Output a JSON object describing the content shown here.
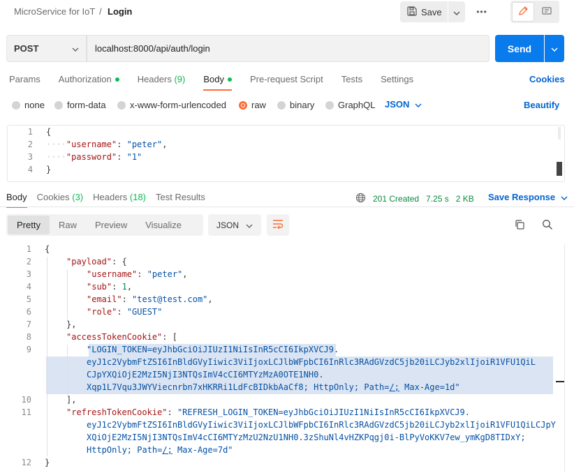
{
  "breadcrumb": {
    "parent": "MicroService for IoT",
    "separator": "/",
    "current": "Login"
  },
  "toolbar": {
    "save_label": "Save",
    "more_label": "•••"
  },
  "request": {
    "method": "POST",
    "url": "localhost:8000/api/auth/login",
    "send_label": "Send"
  },
  "request_tabs": [
    {
      "label": "Params"
    },
    {
      "label": "Authorization",
      "dot": true
    },
    {
      "label": "Headers",
      "count": "(9)"
    },
    {
      "label": "Body",
      "dot": true,
      "active": true
    },
    {
      "label": "Pre-request Script"
    },
    {
      "label": "Tests"
    },
    {
      "label": "Settings"
    }
  ],
  "cookies_label": "Cookies",
  "body_types": {
    "none": "none",
    "form_data": "form-data",
    "urlencoded": "x-www-form-urlencoded",
    "raw": "raw",
    "binary": "binary",
    "graphql": "GraphQL",
    "selected": "raw"
  },
  "raw_format": "JSON",
  "beautify_label": "Beautify",
  "request_body": {
    "line_numbers": [
      "1",
      "2",
      "3",
      "4"
    ],
    "username_key": "\"username\"",
    "username_val": "\"peter\"",
    "password_key": "\"password\"",
    "password_val": "\"1\""
  },
  "response_tabs": {
    "body": "Body",
    "cookies": "Cookies",
    "cookies_count": "(3)",
    "headers": "Headers",
    "headers_count": "(18)",
    "test_results": "Test Results"
  },
  "status": {
    "code": "201 Created",
    "time": "7.25 s",
    "size": "2 KB"
  },
  "save_response_label": "Save Response",
  "view_modes": [
    "Pretty",
    "Raw",
    "Preview",
    "Visualize"
  ],
  "response_format": "JSON",
  "response_body": {
    "line_numbers": [
      "1",
      "2",
      "3",
      "4",
      "5",
      "6",
      "7",
      "8",
      "9",
      "10",
      "11",
      "12"
    ],
    "payload_key": "\"payload\"",
    "username_key": "\"username\"",
    "username_val": "\"peter\"",
    "sub_key": "\"sub\"",
    "sub_val": "1",
    "email_key": "\"email\"",
    "email_val": "\"test@test.com\"",
    "role_key": "\"role\"",
    "role_val": "\"GUEST\"",
    "access_key": "\"accessTokenCookie\"",
    "access_line1": "\"LOGIN_TOKEN=eyJhbGciOiJIUzI1NiIsInR5cCI6IkpXVCJ9.",
    "access_line2": "eyJ1c2VybmFtZSI6InBldGVyIiwic3ViIjoxLCJlbWFpbCI6InRlc3RAdGVzdC5jb20iLCJyb2xlIjoiR1VFU1QiL",
    "access_line3": "CJpYXQiOjE2MzI5NjI3NTQsImV4cCI6MTYzMzA0OTE1NH0.",
    "access_line4a": "Xqp1L7Vqu3JWYViecnrbn7xHKRRi1LdFcBIDkbAaCf8; HttpOnly; Path=",
    "access_line4_link": "/;",
    "access_line4b": " Max-Age=1d\"",
    "refresh_key": "\"refreshTokenCookie\"",
    "refresh_line1": "\"REFRESH_LOGIN_TOKEN=eyJhbGciOiJIUzI1NiIsInR5cCI6IkpXVCJ9.",
    "refresh_line2": "eyJ1c2VybmFtZSI6InBldGVyIiwic3ViIjoxLCJlbWFpbCI6InRlc3RAdGVzdC5jb20iLCJyb2xlIjoiR1VFU1QiLCJpY",
    "refresh_line3": "XQiOjE2MzI5NjI3NTQsImV4cCI6MTYzMzU2NzU1NH0.3zShuNl4vHZKPqgj0i-BlPyVoKKV7ew_ymKgD8TIDxY;",
    "refresh_line4a": "HttpOnly; Path=",
    "refresh_line4_link": "/;",
    "refresh_line4b": " Max-Age=7d\""
  },
  "colors": {
    "accent": "#ff6c37",
    "primary": "#097bed",
    "link": "#0265d2",
    "success": "#0cbb52"
  }
}
